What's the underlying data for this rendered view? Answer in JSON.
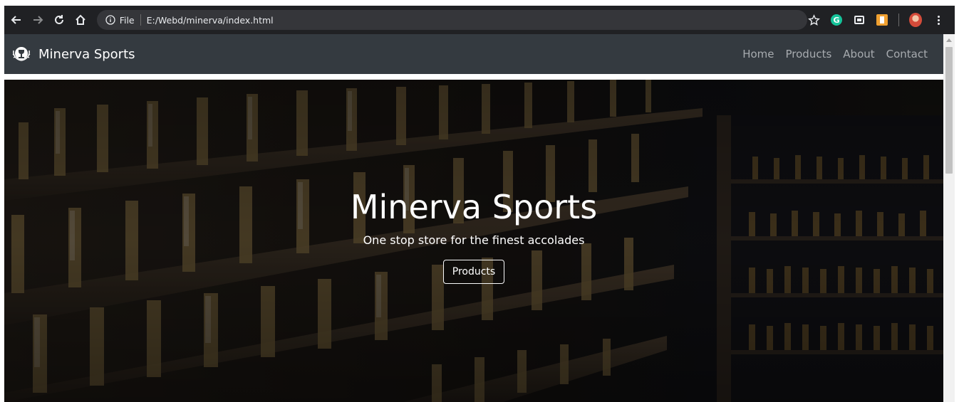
{
  "browser": {
    "address": {
      "scheme_label": "File",
      "url": "E:/Webd/minerva/index.html"
    },
    "icons": [
      "back-arrow-icon",
      "forward-arrow-icon",
      "reload-icon",
      "home-icon",
      "info-icon",
      "star-icon",
      "grammarly-extension-icon",
      "window-extension-icon",
      "orange-extension-icon",
      "profile-avatar-icon",
      "kebab-menu-icon"
    ]
  },
  "navbar": {
    "brand": "Minerva Sports",
    "links": [
      "Home",
      "Products",
      "About",
      "Contact"
    ]
  },
  "hero": {
    "title": "Minerva Sports",
    "subtitle": "One stop store for the finest accolades",
    "button_label": "Products"
  },
  "colors": {
    "navbar_bg": "#343a40",
    "nav_link": "#a7abaf",
    "chrome_bg": "#202124",
    "omnibox_bg": "#35363a"
  }
}
